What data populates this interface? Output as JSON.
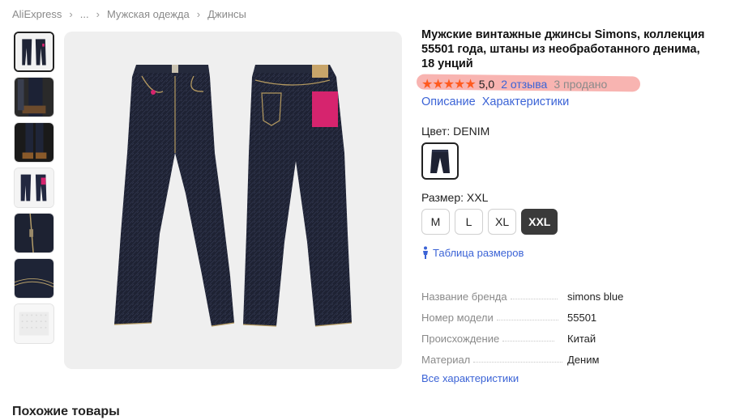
{
  "breadcrumb": {
    "items": [
      "AliExpress",
      "...",
      "Мужская одежда",
      "Джинсы"
    ]
  },
  "product": {
    "title": "Мужские винтажные джинсы Simons, коллекция 55501 года, штаны из необработанного денима, 18 унций",
    "rating": {
      "stars": "★★★★★",
      "score": "5,0",
      "reviews": "2 отзыва",
      "sold": "3 продано"
    },
    "links": {
      "description": "Описание",
      "characteristics": "Характеристики"
    },
    "color": {
      "label": "Цвет: DENIM"
    },
    "size": {
      "label": "Размер: XXL",
      "options": [
        "M",
        "L",
        "XL",
        "XXL"
      ],
      "selected": "XXL"
    },
    "size_table": "Таблица размеров",
    "specs": [
      {
        "key": "Название бренда",
        "value": "simons blue"
      },
      {
        "key": "Номер модели",
        "value": "55501"
      },
      {
        "key": "Происхождение",
        "value": "Китай"
      },
      {
        "key": "Материал",
        "value": "Деним"
      }
    ],
    "all_specs": "Все характеристики"
  },
  "similar_title": "Похожие товары",
  "colors": {
    "accent": "#3b63d6",
    "star": "#ff5a1f",
    "highlight": "#f7a7a3",
    "denim": "#1e2233",
    "selected_size_bg": "#3a3a3a"
  },
  "icons": {
    "breadcrumb_separator": "chevron-right-icon",
    "size_table": "person-icon"
  }
}
